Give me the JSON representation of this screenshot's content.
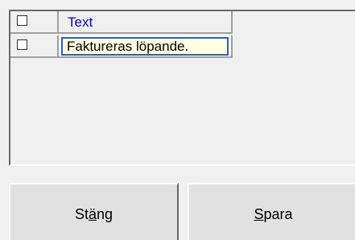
{
  "grid": {
    "header": {
      "checked": false,
      "text": "Text"
    },
    "rows": [
      {
        "checked": false,
        "text": "Faktureras löpande."
      }
    ]
  },
  "buttons": {
    "close": {
      "prefix": "St",
      "mnemonic": "ä",
      "suffix": "ng"
    },
    "save": {
      "prefix": "",
      "mnemonic": "S",
      "suffix": "para"
    }
  },
  "colors": {
    "header_text": "#0000e6",
    "edit_background": "#ffffe1",
    "edit_border": "#2a5fcf",
    "window_background": "#f0f0f0"
  }
}
